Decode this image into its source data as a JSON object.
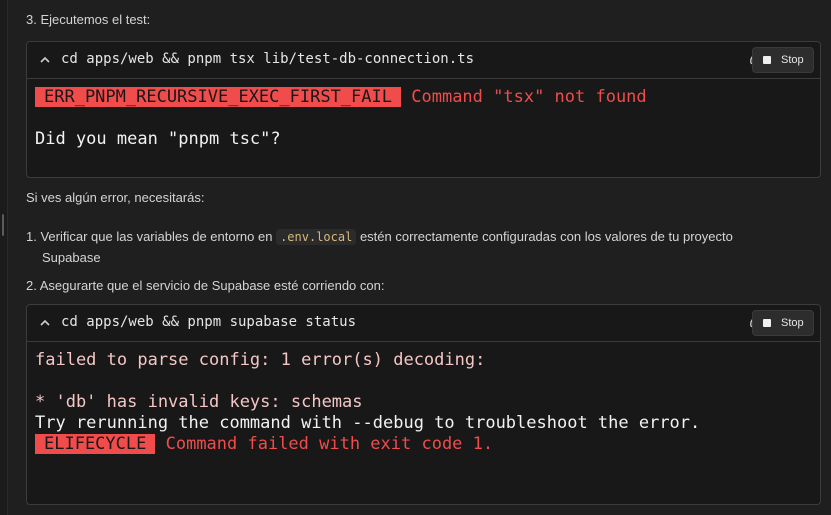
{
  "step3_heading": "3. Ejecutemos el test:",
  "terminal1": {
    "command": "cd apps/web && pnpm tsx lib/test-db-connection.ts",
    "stop_label": "Stop",
    "error_badge": "ERR_PNPM_RECURSIVE_EXEC_FIRST_FAIL",
    "error_message": "Command \"tsx\" not found",
    "suggestion": "Did you mean \"pnpm tsc\"?"
  },
  "if_error_text": "Si ves algún error, necesitarás:",
  "list": {
    "item1_num": "1.",
    "item1_before": "Verificar que las variables de entorno en",
    "item1_code": ".env.local",
    "item1_after": "estén correctamente configuradas con los valores de tu proyecto",
    "item1_line2": "Supabase",
    "item2_num": "2.",
    "item2_text": "Asegurarte que el servicio de Supabase esté corriendo con:"
  },
  "terminal2": {
    "command": "cd apps/web && pnpm supabase status",
    "stop_label": "Stop",
    "line1": "failed to parse config: 1 error(s) decoding:",
    "line2": "* 'db' has invalid keys: schemas",
    "line3": "Try rerunning the command with --debug to troubleshoot the error.",
    "error_badge": "ELIFECYCLE",
    "error_message": "Command failed with exit code 1."
  },
  "icons": {
    "chevron": "chevron-up-icon",
    "shell": "shell-icon",
    "stop": "stop-square-icon"
  },
  "colors": {
    "error": "#f14c4c",
    "background": "#1f1f1f",
    "terminal_bg": "#181818"
  }
}
